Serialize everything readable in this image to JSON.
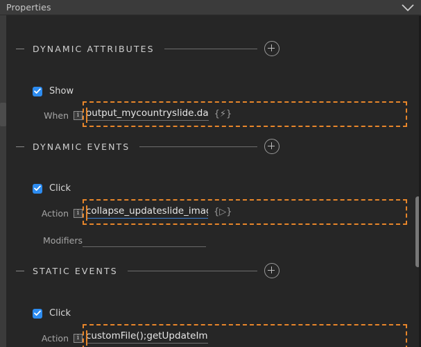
{
  "window": {
    "title": "Properties",
    "collapse_icon": "chevron-down-icon"
  },
  "sections": [
    {
      "title": "DYNAMIC ATTRIBUTES",
      "collapse_icon": "minus-icon",
      "add_icon": "plus-circle-icon",
      "checkbox": {
        "label": "Show",
        "checked": true
      },
      "fields": [
        {
          "label": "When",
          "info_icon": "info-icon",
          "info_glyph": "i",
          "value": "output_mycountryslide.da",
          "glyph": "{⚡}",
          "glyph_name": "lightning-bolt-icon",
          "underline": "grey",
          "bound": true
        }
      ]
    },
    {
      "title": "DYNAMIC EVENTS",
      "collapse_icon": "minus-icon",
      "add_icon": "plus-circle-icon",
      "checkbox": {
        "label": "Click",
        "checked": true
      },
      "fields": [
        {
          "label": "Action",
          "info_icon": "info-icon",
          "info_glyph": "i",
          "value": "collapse_updateslide_imag",
          "glyph": "{▷}",
          "glyph_name": "play-triangle-icon",
          "underline": "blue",
          "bound": true
        },
        {
          "label": "Modifiers",
          "info_icon": null,
          "info_glyph": "",
          "value": "",
          "glyph": "",
          "glyph_name": "",
          "underline": "grey",
          "bound": false
        }
      ]
    },
    {
      "title": "STATIC EVENTS",
      "collapse_icon": "minus-icon",
      "add_icon": "plus-circle-icon",
      "checkbox": {
        "label": "Click",
        "checked": true
      },
      "fields": [
        {
          "label": "Action",
          "info_icon": "info-icon",
          "info_glyph": "i",
          "value": "customFile();getUpdateIm",
          "glyph": "",
          "glyph_name": "",
          "underline": "grey",
          "bound": true
        }
      ]
    }
  ],
  "colors": {
    "panel_bg": "#262626",
    "titlebar_bg": "#3b3b3b",
    "accent_orange": "#e8862a",
    "accent_blue": "#2d8cf0",
    "underline_blue": "#3f7fd0",
    "text_primary": "#e6e6e6",
    "text_muted": "#a6a6a6"
  },
  "scrollbar": {
    "name": "vertical-scrollbar"
  }
}
